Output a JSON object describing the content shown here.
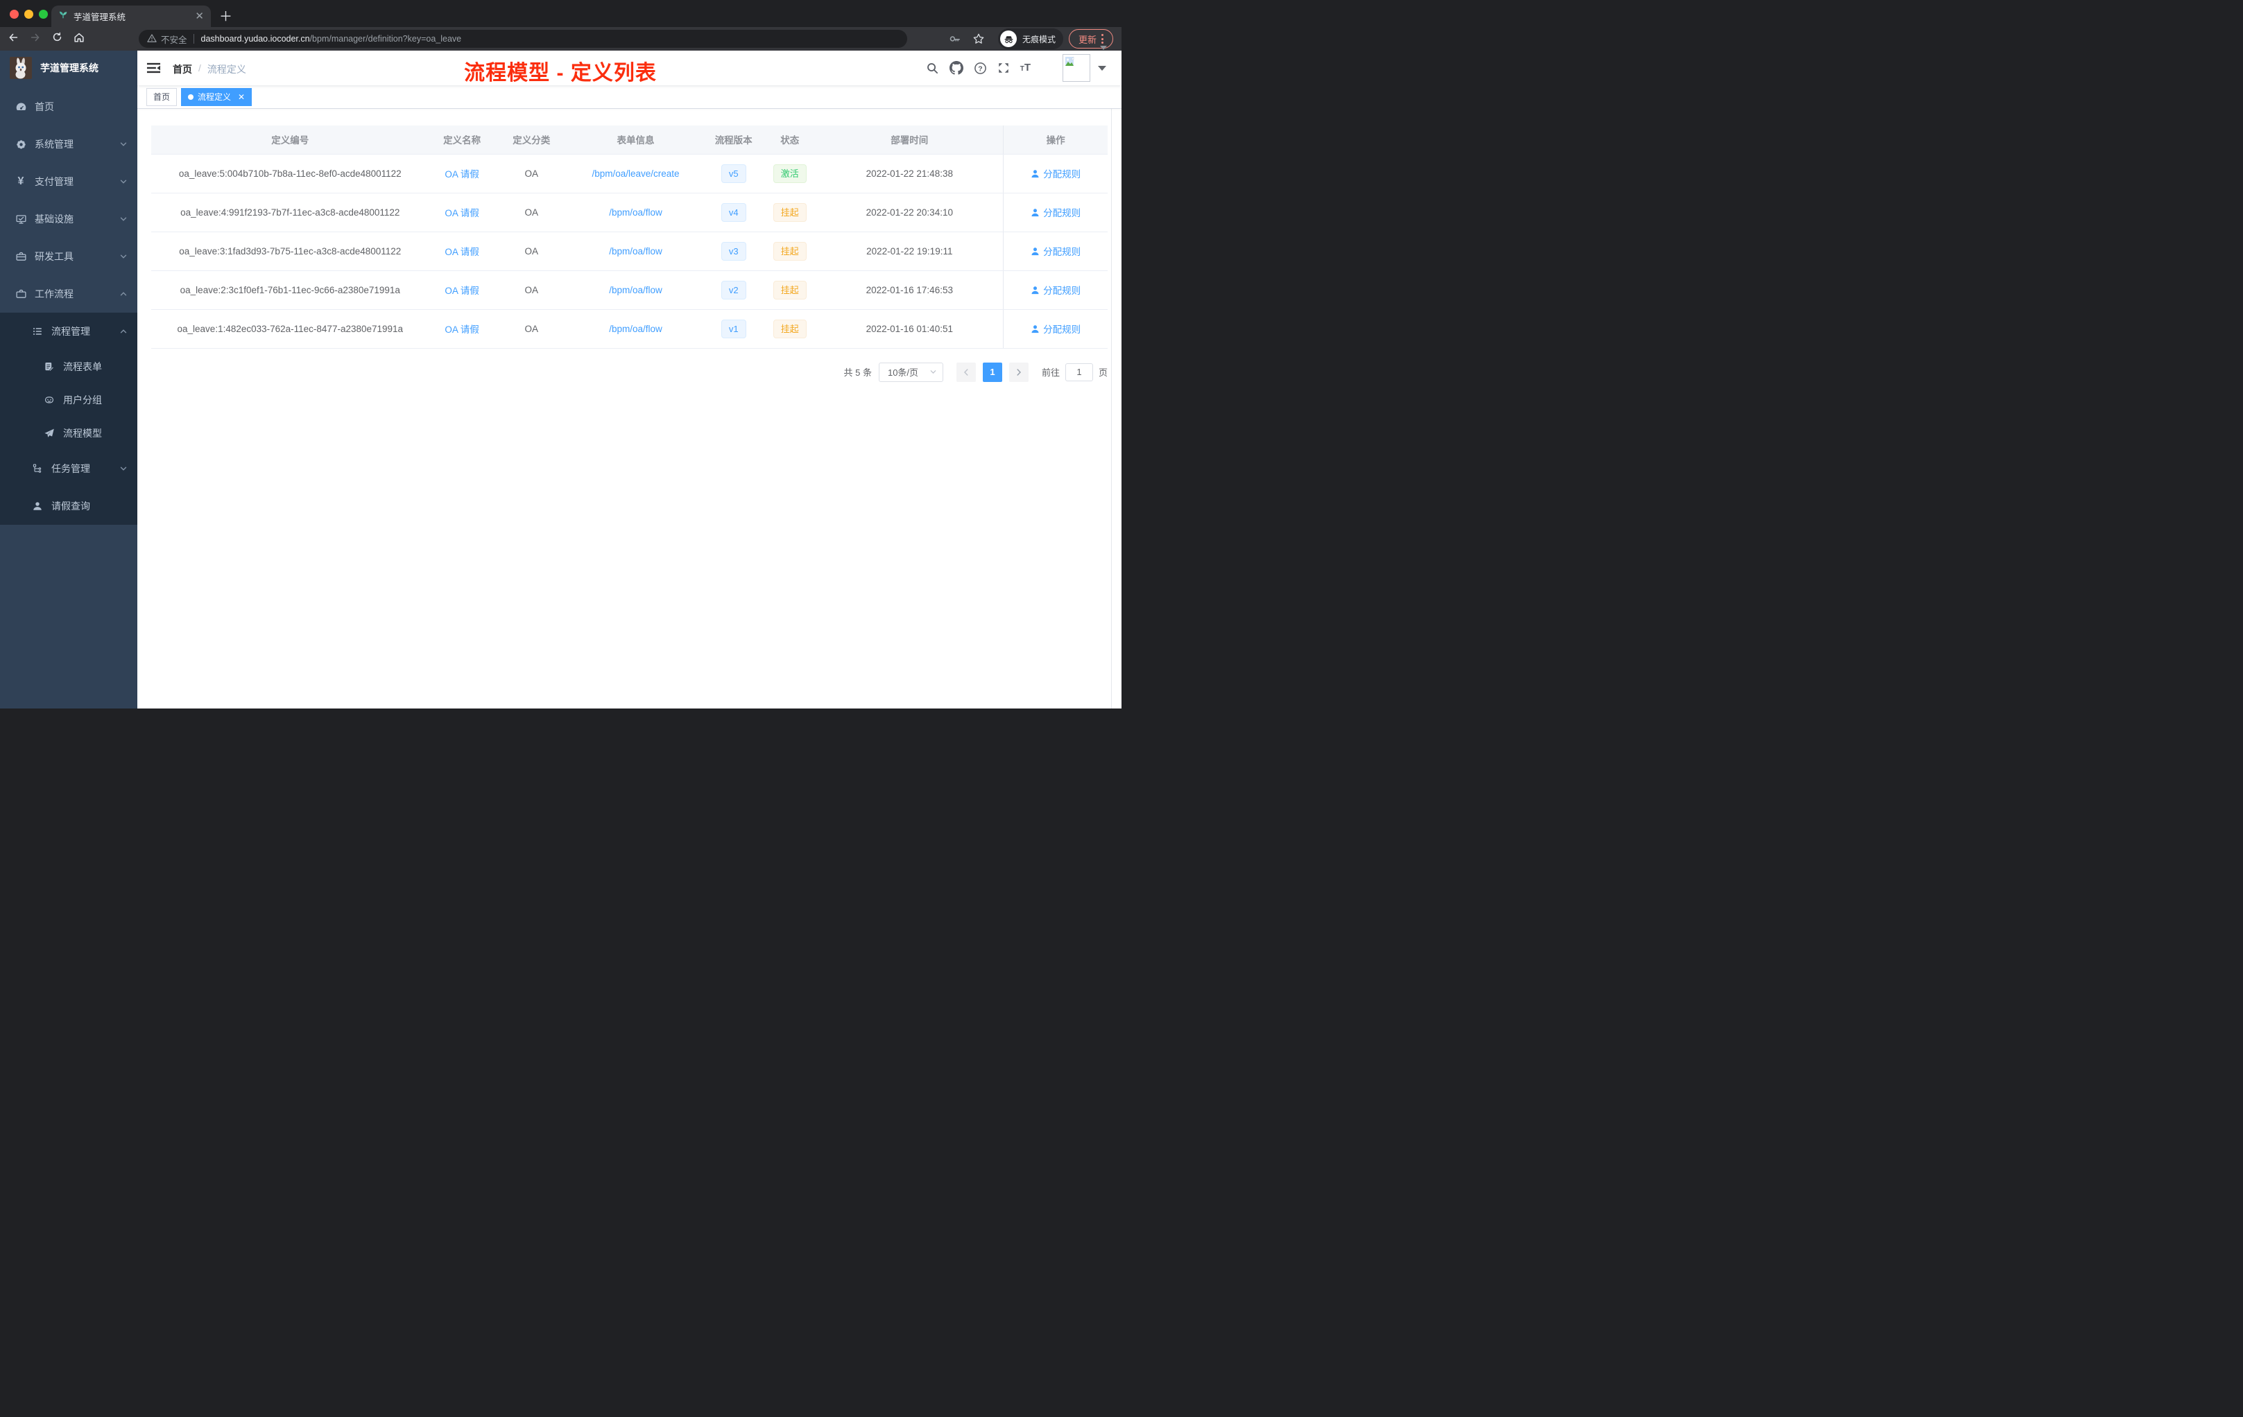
{
  "browser": {
    "tab_title": "芋道管理系统",
    "security_label": "不安全",
    "url_domain": "dashboard.yudao.iocoder.cn",
    "url_path": "/bpm/manager/definition?key=oa_leave",
    "incognito_label": "无痕模式",
    "update_label": "更新"
  },
  "sidebar": {
    "logo_title": "芋道管理系统",
    "items": [
      {
        "label": "首页",
        "icon": "dashboard-icon"
      },
      {
        "label": "系统管理",
        "icon": "gear-icon"
      },
      {
        "label": "支付管理",
        "icon": "yen-icon"
      },
      {
        "label": "基础设施",
        "icon": "monitor-icon"
      },
      {
        "label": "研发工具",
        "icon": "toolbox-icon"
      },
      {
        "label": "工作流程",
        "icon": "briefcase-icon"
      }
    ],
    "sub": [
      {
        "label": "流程管理",
        "icon": "list-icon"
      },
      {
        "label": "流程表单",
        "icon": "form-icon"
      },
      {
        "label": "用户分组",
        "icon": "robot-icon"
      },
      {
        "label": "流程模型",
        "icon": "paper-plane-icon"
      },
      {
        "label": "任务管理",
        "icon": "tree-icon"
      },
      {
        "label": "请假查询",
        "icon": "user-icon"
      }
    ]
  },
  "navbar": {
    "breadcrumb_home": "首页",
    "breadcrumb_separator": "/",
    "breadcrumb_current": "流程定义",
    "annotation": "流程模型 - 定义列表"
  },
  "tags_view": {
    "home": "首页",
    "active": "流程定义"
  },
  "table": {
    "columns": [
      "定义编号",
      "定义名称",
      "定义分类",
      "表单信息",
      "流程版本",
      "状态",
      "部署时间",
      "操作"
    ],
    "rows": [
      {
        "id": "oa_leave:5:004b710b-7b8a-11ec-8ef0-acde48001122",
        "name": "OA 请假",
        "category": "OA",
        "form": "/bpm/oa/leave/create",
        "version": "v5",
        "status": "激活",
        "status_type": "success",
        "deploy_time": "2022-01-22 21:48:38",
        "action": "分配规则"
      },
      {
        "id": "oa_leave:4:991f2193-7b7f-11ec-a3c8-acde48001122",
        "name": "OA 请假",
        "category": "OA",
        "form": "/bpm/oa/flow",
        "version": "v4",
        "status": "挂起",
        "status_type": "warning",
        "deploy_time": "2022-01-22 20:34:10",
        "action": "分配规则"
      },
      {
        "id": "oa_leave:3:1fad3d93-7b75-11ec-a3c8-acde48001122",
        "name": "OA 请假",
        "category": "OA",
        "form": "/bpm/oa/flow",
        "version": "v3",
        "status": "挂起",
        "status_type": "warning",
        "deploy_time": "2022-01-22 19:19:11",
        "action": "分配规则"
      },
      {
        "id": "oa_leave:2:3c1f0ef1-76b1-11ec-9c66-a2380e71991a",
        "name": "OA 请假",
        "category": "OA",
        "form": "/bpm/oa/flow",
        "version": "v2",
        "status": "挂起",
        "status_type": "warning",
        "deploy_time": "2022-01-16 17:46:53",
        "action": "分配规则"
      },
      {
        "id": "oa_leave:1:482ec033-762a-11ec-8477-a2380e71991a",
        "name": "OA 请假",
        "category": "OA",
        "form": "/bpm/oa/flow",
        "version": "v1",
        "status": "挂起",
        "status_type": "warning",
        "deploy_time": "2022-01-16 01:40:51",
        "action": "分配规则"
      }
    ]
  },
  "pagination": {
    "total": "共 5 条",
    "page_size": "10条/页",
    "current": "1",
    "goto": "前往",
    "goto_value": "1",
    "unit": "页"
  },
  "colors": {
    "accent": "#409eff",
    "success": "#31c96f",
    "warning": "#f3a821",
    "annotation_red": "#fb2e0e",
    "sidebar_bg": "#304156",
    "submenu_bg": "#1f2d3d",
    "active_tag": "#409eff"
  }
}
